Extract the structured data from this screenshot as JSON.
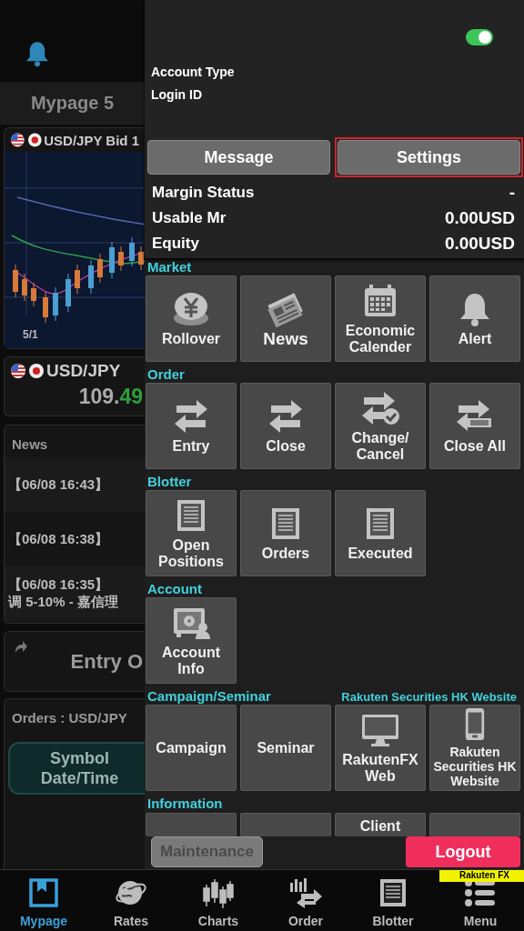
{
  "left_panel": {
    "page_title": "Mypage 5",
    "chart_card": {
      "title": "USD/JPY Bid 1",
      "axis_label": "5/1"
    },
    "rate_card": {
      "symbol": "USD/JPY",
      "price_main": "109.",
      "price_pips": "49"
    },
    "news_card": {
      "title": "News",
      "items": [
        {
          "time": "【06/08 16:43】"
        },
        {
          "time": "【06/08 16:38】"
        },
        {
          "time": "【06/08 16:35】",
          "headline": "调 5-10% - 嘉信理"
        }
      ]
    },
    "entry_card": {
      "label": "Entry O"
    },
    "orders_card": {
      "title": "Orders : USD/JPY",
      "sort_button": [
        "Symbol",
        "Date/Time"
      ]
    }
  },
  "drawer": {
    "toggle": {
      "on": true
    },
    "account_type_label": "Account Type",
    "login_id_label": "Login ID",
    "buttons": [
      {
        "label": "Message",
        "highlighted": false
      },
      {
        "label": "Settings",
        "highlighted": true
      }
    ],
    "account_rows": [
      {
        "label": "Margin Status",
        "value": "-"
      },
      {
        "label": "Usable Mr",
        "value": "0.00USD"
      },
      {
        "label": "Equity",
        "value": "0.00USD"
      }
    ],
    "sections": [
      {
        "title": "Market",
        "tiles": [
          {
            "label": "Rollover",
            "kind": "coin"
          },
          {
            "label": "News",
            "kind": "newspaper"
          },
          {
            "label": "Economic Calender",
            "kind": "calendar"
          },
          {
            "label": "Alert",
            "kind": "bell"
          }
        ]
      },
      {
        "title": "Order",
        "tiles": [
          {
            "label": "Entry",
            "kind": "arrows"
          },
          {
            "label": "Close",
            "kind": "arrows"
          },
          {
            "label": "Change/Cancel",
            "kind": "arrows-check"
          },
          {
            "label": "Close All",
            "kind": "arrows-tag"
          }
        ]
      },
      {
        "title": "Blotter",
        "tiles": [
          {
            "label": "Open Positions",
            "kind": "list"
          },
          {
            "label": "Orders",
            "kind": "list"
          },
          {
            "label": "Executed",
            "kind": "list"
          }
        ]
      },
      {
        "title": "Account",
        "tiles": [
          {
            "label": "Account Info",
            "kind": "safe"
          }
        ]
      },
      {
        "title": "Campaign/Seminar",
        "link": "Rakuten Securities HK Website",
        "tiles": [
          {
            "label": "Campaign",
            "kind": "text"
          },
          {
            "label": "Seminar",
            "kind": "text"
          },
          {
            "label": "RakutenFX Web",
            "kind": "monitor"
          },
          {
            "label": "Rakuten Securities HK Website",
            "kind": "phone"
          }
        ]
      },
      {
        "title": "Information",
        "cut": true,
        "tiles": [
          {
            "kind": "text"
          },
          {
            "kind": "text"
          },
          {
            "label": "Client",
            "kind": "text"
          },
          {
            "kind": "text"
          }
        ]
      }
    ],
    "footer": {
      "maintenance": {
        "label": "Maintenance",
        "disabled": true
      },
      "logout": {
        "label": "Logout"
      }
    }
  },
  "tab_bar": {
    "badge": "Rakuten FX",
    "tabs": [
      {
        "label": "Mypage",
        "kind": "bookmark",
        "selected": true
      },
      {
        "label": "Rates",
        "kind": "globe",
        "selected": false
      },
      {
        "label": "Charts",
        "kind": "candles",
        "selected": false
      },
      {
        "label": "Order",
        "kind": "order",
        "selected": false
      },
      {
        "label": "Blotter",
        "kind": "list",
        "selected": false
      },
      {
        "label": "Menu",
        "kind": "menu",
        "selected": false
      }
    ]
  }
}
